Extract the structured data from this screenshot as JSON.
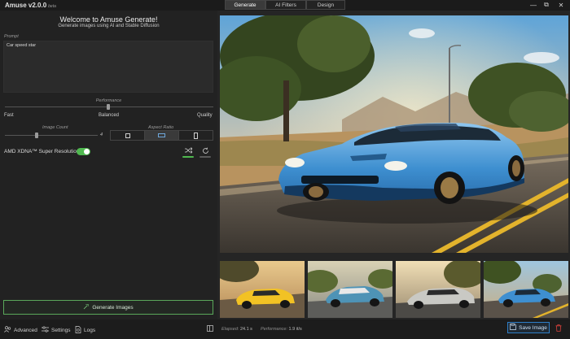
{
  "app": {
    "name": "Amuse v2.0.0",
    "badge": "beta"
  },
  "tabs": [
    {
      "label": "Generate",
      "active": true
    },
    {
      "label": "AI Filters",
      "active": false
    },
    {
      "label": "Design",
      "active": false
    }
  ],
  "window_controls": [
    {
      "icon": "minimize-icon",
      "glyph": "—"
    },
    {
      "icon": "restore-icon",
      "glyph": "⧉"
    },
    {
      "icon": "close-icon",
      "glyph": "✕"
    }
  ],
  "left_panel": {
    "title": "Welcome to Amuse Generate!",
    "subtitle": "Generate images using AI and Stable Diffusion",
    "prompt": {
      "label": "Prompt",
      "value": "Car speed star"
    },
    "performance": {
      "label": "Performance",
      "value": 0.5,
      "ticks": [
        "Fast",
        "Balanced",
        "Quality"
      ]
    },
    "image_count": {
      "label": "Image Count",
      "value": "4",
      "level": 0.33
    },
    "aspect_ratio": {
      "label": "Aspect Ratio",
      "options": [
        "square",
        "landscape",
        "portrait"
      ],
      "selected": "landscape"
    },
    "super_resolution": {
      "label": "AMD XDNA™ Super Resolution",
      "enabled": true
    },
    "shuffle_icon": "shuffle-icon",
    "refresh_icon": "refresh-icon",
    "generate_button": {
      "label": "Generate Images",
      "icon": "sparkle-icon"
    }
  },
  "gallery": {
    "main_image": "Blue sports car driving on a desert road",
    "thumbnails": [
      "yellow sports car",
      "blue and white sports car",
      "silver sports car",
      "blue sports car"
    ]
  },
  "statusbar": {
    "advanced": "Advanced",
    "settings": "Settings",
    "logs": "Logs",
    "elapsed_label": "Elapsed:",
    "elapsed_value": "24.1 s",
    "performance_label": "Performance:",
    "performance_value": "1.9 it/s",
    "save_button": "Save Image"
  },
  "colors": {
    "accent_green": "#4fb84f",
    "accent_blue": "#2f7fc8",
    "delete_red": "#d8413b"
  }
}
